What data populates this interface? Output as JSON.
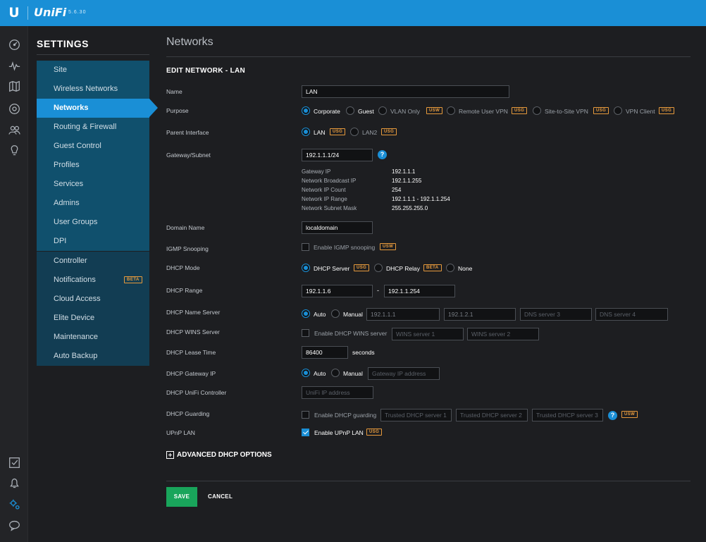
{
  "header": {
    "brand": "UniFi",
    "logo": "U",
    "version": "5.6.30",
    "accent_color": "#1a8fd6"
  },
  "rail": {
    "top_icons": [
      "dashboard-icon",
      "statistics-icon",
      "map-icon",
      "devices-icon",
      "clients-icon",
      "insights-icon"
    ],
    "bottom_icons": [
      "alerts-checkbox-icon",
      "bell-icon",
      "settings-gears-icon",
      "chat-icon"
    ]
  },
  "sidebar": {
    "title": "SETTINGS",
    "group1": [
      "Site",
      "Wireless Networks",
      "Networks",
      "Routing & Firewall",
      "Guest Control",
      "Profiles",
      "Services",
      "Admins",
      "User Groups",
      "DPI"
    ],
    "group2": [
      "Controller",
      "Notifications",
      "Cloud Access",
      "Elite Device",
      "Maintenance",
      "Auto Backup"
    ],
    "active": "Networks",
    "notifications_badge": "BETA"
  },
  "main": {
    "page_title": "Networks",
    "section_title": "EDIT NETWORK - LAN",
    "name": {
      "label": "Name",
      "value": "LAN"
    },
    "purpose": {
      "label": "Purpose",
      "options": [
        "Corporate",
        "Guest",
        "VLAN Only",
        "Remote User VPN",
        "Site-to-Site VPN",
        "VPN Client"
      ],
      "tags": [
        "USW",
        "USG",
        "USG",
        "USG"
      ],
      "selected": "Corporate"
    },
    "parent_interface": {
      "label": "Parent Interface",
      "options": [
        "LAN",
        "LAN2"
      ],
      "tags": [
        "USG",
        "USG"
      ],
      "selected": "LAN"
    },
    "gateway": {
      "label": "Gateway/Subnet",
      "value": "192.1.1.1/24",
      "help": "?",
      "info": [
        {
          "key": "Gateway IP",
          "value": "192.1.1.1"
        },
        {
          "key": "Network Broadcast IP",
          "value": "192.1.1.255"
        },
        {
          "key": "Network IP Count",
          "value": "254"
        },
        {
          "key": "Network IP Range",
          "value": "192.1.1.1 - 192.1.1.254"
        },
        {
          "key": "Network Subnet Mask",
          "value": "255.255.255.0"
        }
      ]
    },
    "domain_name": {
      "label": "Domain Name",
      "value": "localdomain"
    },
    "igmp": {
      "label": "IGMP Snooping",
      "option": "Enable IGMP snooping",
      "tag": "USW",
      "checked": false
    },
    "dhcp_mode": {
      "label": "DHCP Mode",
      "options": [
        "DHCP Server",
        "DHCP Relay",
        "None"
      ],
      "tags": [
        "USG",
        "BETA"
      ],
      "selected": "DHCP Server"
    },
    "dhcp_range": {
      "label": "DHCP Range",
      "start": "192.1.1.6",
      "separator": "-",
      "end": "192.1.1.254"
    },
    "dhcp_name_server": {
      "label": "DHCP Name Server",
      "options": [
        "Auto",
        "Manual"
      ],
      "selected": "Auto",
      "servers": [
        "192.1.1.1",
        "192.1.2.1"
      ],
      "placeholders": [
        "DNS server 3",
        "DNS server 4"
      ]
    },
    "dhcp_wins": {
      "label": "DHCP WINS Server",
      "option": "Enable DHCP WINS server",
      "checked": false,
      "placeholders": [
        "WINS server 1",
        "WINS server 2"
      ]
    },
    "dhcp_lease": {
      "label": "DHCP Lease Time",
      "value": "86400",
      "unit": "seconds"
    },
    "dhcp_gateway": {
      "label": "DHCP Gateway IP",
      "options": [
        "Auto",
        "Manual"
      ],
      "selected": "Auto",
      "placeholder": "Gateway IP address"
    },
    "dhcp_controller": {
      "label": "DHCP UniFi Controller",
      "placeholder": "UniFi IP address"
    },
    "dhcp_guarding": {
      "label": "DHCP Guarding",
      "option": "Enable DHCP guarding",
      "checked": false,
      "placeholders": [
        "Trusted DHCP server 1",
        "Trusted DHCP server 2",
        "Trusted DHCP server 3"
      ],
      "help": "?",
      "tag": "USW"
    },
    "upnp": {
      "label": "UPnP LAN",
      "option": "Enable UPnP LAN",
      "tag": "USG",
      "checked": true
    },
    "advanced": "ADVANCED DHCP OPTIONS",
    "save": "SAVE",
    "cancel": "CANCEL"
  }
}
